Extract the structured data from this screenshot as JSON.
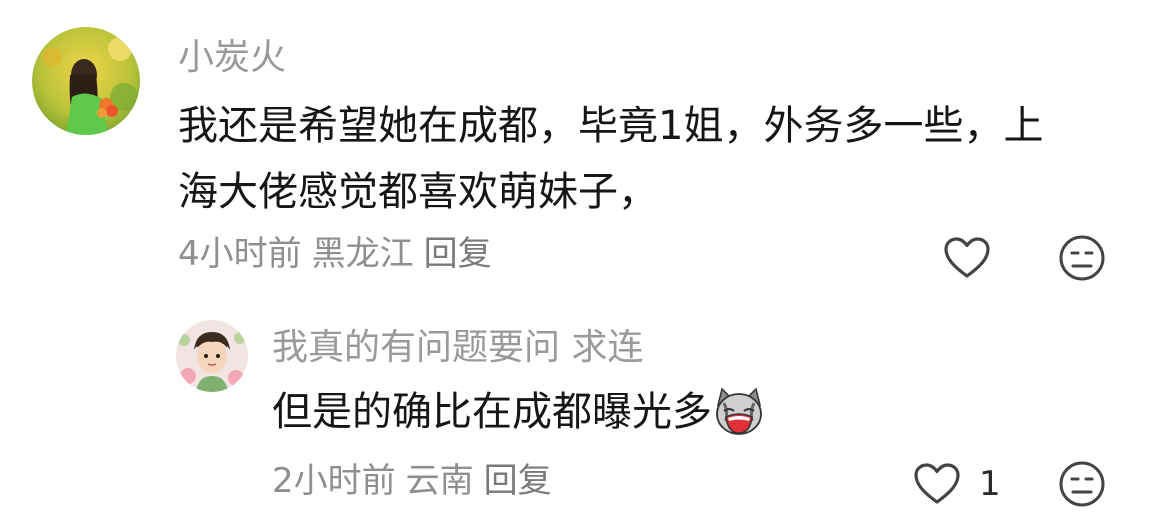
{
  "comments": [
    {
      "username": "小炭火",
      "body_lines": [
        "我还是希望她在成都，毕竟1姐，外务多一些，上",
        "海大佬感觉都喜欢萌妹子，"
      ],
      "time": "4小时前",
      "location": "黑龙江",
      "reply_label": "回复",
      "like_count": "",
      "avatar_icon": "avatar-girl-flowers",
      "like_icon": "heart-outline-icon",
      "dislike_icon": "meh-face-icon"
    },
    {
      "username": "我真的有问题要问 求连",
      "body_text": "但是的确比在成都曝光多",
      "body_emoji": "cat-crying-emoji",
      "time": "2小时前",
      "location": "云南",
      "reply_label": "回复",
      "like_count": "1",
      "avatar_icon": "avatar-cartoon-boy",
      "like_icon": "heart-outline-icon",
      "dislike_icon": "meh-face-icon"
    }
  ],
  "colors": {
    "username": "#9a9a9a",
    "body": "#161616",
    "meta": "#8f8f8f",
    "icon_stroke": "#444444"
  }
}
